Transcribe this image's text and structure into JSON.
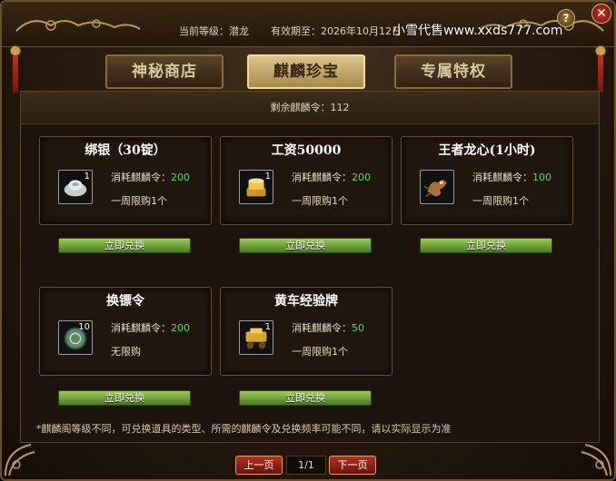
{
  "header": {
    "level_label": "当前等级：潜龙",
    "expiry_label": "有效期至：2026年10月12日",
    "watermark": "小雪代售www.xxds777.com",
    "help": "?",
    "close": "✕"
  },
  "tabs": [
    {
      "label": "神秘商店",
      "active": false
    },
    {
      "label": "麒麟珍宝",
      "active": true
    },
    {
      "label": "专属特权",
      "active": false
    }
  ],
  "remain_label": "剩余麒麟令：112",
  "items": [
    {
      "title": "绑银（30锭）",
      "icon": "silver-ingot-icon",
      "count": "1",
      "cost_label": "消耗麒麟令：",
      "cost": "200",
      "limit": "一周限购1个",
      "button": "立即兑换"
    },
    {
      "title": "工资50000",
      "icon": "gold-coin-stack-icon",
      "count": "1",
      "cost_label": "消耗麒麟令：",
      "cost": "200",
      "limit": "一周限购1个",
      "button": "立即兑换"
    },
    {
      "title": "王者龙心(1小时)",
      "icon": "dragon-heart-icon",
      "count": "",
      "cost_label": "消耗麒麟令：",
      "cost": "100",
      "limit": "一周限购1个",
      "button": "立即兑换"
    },
    {
      "title": "换镖令",
      "icon": "escort-token-icon",
      "count": "10",
      "cost_label": "消耗麒麟令：",
      "cost": "200",
      "limit": "无限购",
      "button": "立即兑换"
    },
    {
      "title": "黄车经验牌",
      "icon": "gold-cart-icon",
      "count": "1",
      "cost_label": "消耗麒麟令：",
      "cost": "50",
      "limit": "一周限购1个",
      "button": "立即兑换"
    }
  ],
  "note": "*麒麟阁等级不同，可兑换道具的类型、所需的麒麟令及兑换频率可能不同，请以实际显示为准",
  "pager": {
    "prev": "上一页",
    "page": "1/1",
    "next": "下一页"
  },
  "colors": {
    "accent_gold": "#d9c58e",
    "cost_green": "#4fe04f",
    "button_green": "#7aa83a",
    "pager_red": "#a02818"
  }
}
